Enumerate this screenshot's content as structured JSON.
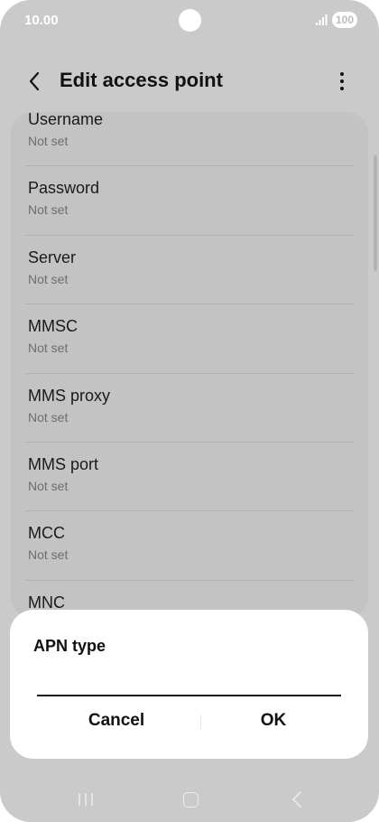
{
  "status_bar": {
    "time": "10.00",
    "battery": "100",
    "signal_icon": "signal-icon"
  },
  "header": {
    "title": "Edit access point",
    "back_icon": "chevron-left-icon",
    "more_icon": "more-vertical-icon"
  },
  "list": {
    "items": [
      {
        "title": "Username",
        "value": "Not set"
      },
      {
        "title": "Password",
        "value": "Not set"
      },
      {
        "title": "Server",
        "value": "Not set"
      },
      {
        "title": "MMSC",
        "value": "Not set"
      },
      {
        "title": "MMS proxy",
        "value": "Not set"
      },
      {
        "title": "MMS port",
        "value": "Not set"
      },
      {
        "title": "MCC",
        "value": "Not set"
      },
      {
        "title": "MNC",
        "value": ""
      }
    ]
  },
  "dialog": {
    "title": "APN type",
    "input_value": "",
    "cancel_label": "Cancel",
    "ok_label": "OK"
  },
  "nav_bar": {
    "recent_icon": "recent-apps-icon",
    "home_icon": "home-icon",
    "back_icon": "back-icon"
  },
  "colors": {
    "dim_background": "#cacaca",
    "card": "#c3c3c3",
    "dialog": "#ffffff",
    "text_primary": "#111111",
    "text_secondary": "#6e6e6e"
  }
}
